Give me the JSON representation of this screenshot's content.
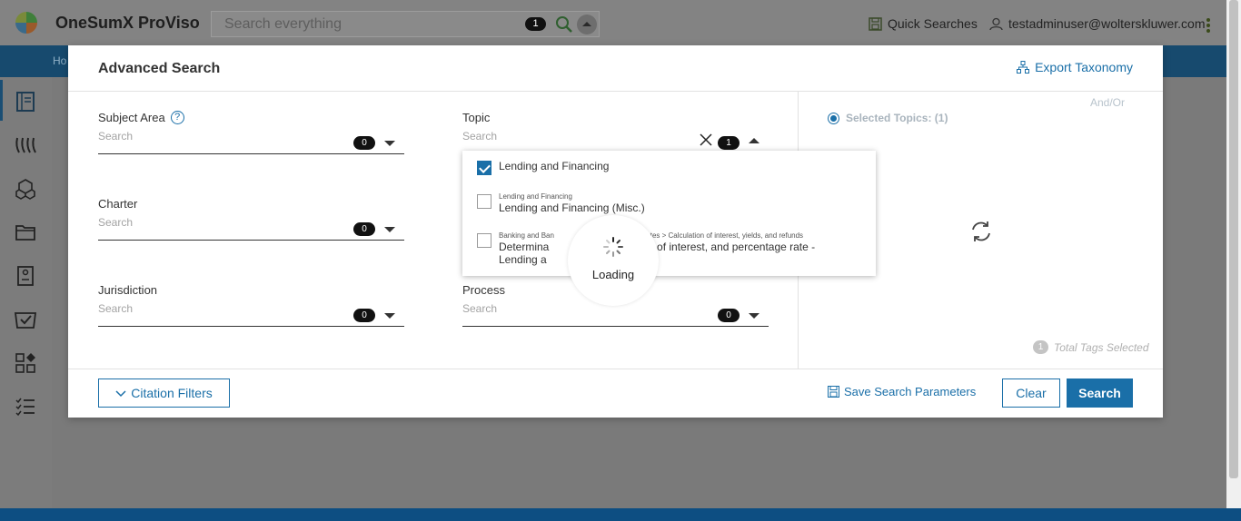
{
  "header": {
    "app_title": "OneSumX ProViso",
    "search_placeholder": "Search everything",
    "search_count": "1",
    "quick_searches": "Quick Searches",
    "user_email": "testadminuser@wolterskluwer.com"
  },
  "nav": {
    "home_label": "Ho"
  },
  "modal": {
    "title": "Advanced Search",
    "export_label": "Export Taxonomy",
    "fields": {
      "subject_area": {
        "label": "Subject Area",
        "placeholder": "Search",
        "count": "0"
      },
      "topic": {
        "label": "Topic",
        "placeholder": "Search",
        "count": "1"
      },
      "charter": {
        "label": "Charter",
        "placeholder": "Search",
        "count": "0"
      },
      "jurisdiction": {
        "label": "Jurisdiction",
        "placeholder": "Search",
        "count": "0"
      },
      "process": {
        "label": "Process",
        "placeholder": "Search",
        "count": "0"
      }
    },
    "topic_options": [
      {
        "path": "",
        "name": "Lending and Financing",
        "checked": true
      },
      {
        "path": "Lending and Financing",
        "name": "Lending and Financing (Misc.)",
        "checked": false
      },
      {
        "path": "Banking and Ban",
        "path_tail": "d Interest Rates > Calculation of interest, yields, and refunds",
        "name": "Determina",
        "name_tail": "tion of interest, and percentage rate -",
        "name_line2": "Lending a",
        "checked": false
      }
    ],
    "right_pane": {
      "and_or": "And/Or",
      "selected_topics": "Selected Topics: (1)",
      "total_count": "1",
      "total_label": "Total Tags Selected"
    },
    "footer": {
      "citation_filters": "Citation Filters",
      "save_params": "Save Search Parameters",
      "clear": "Clear",
      "search": "Search"
    }
  },
  "loading": {
    "label": "Loading"
  },
  "colors": {
    "accent": "#1a6fa8",
    "navbar": "#174a6e",
    "bottom_bar": "#0d4e82"
  }
}
